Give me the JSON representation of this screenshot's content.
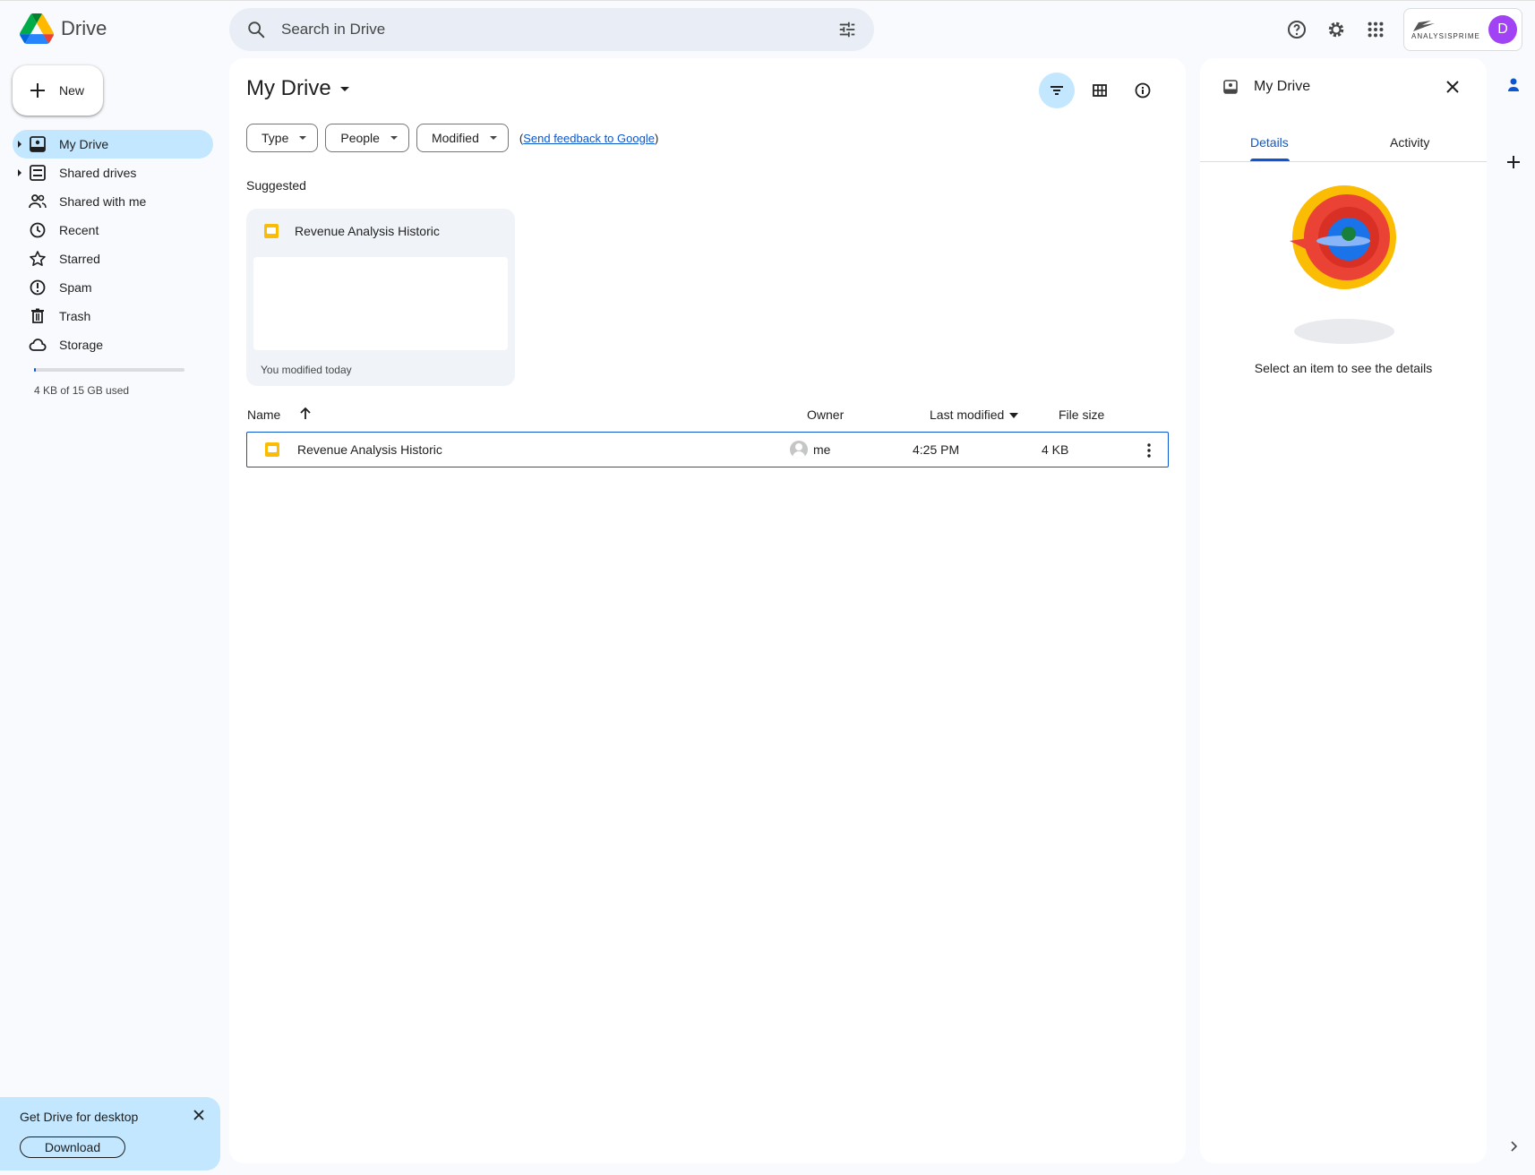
{
  "app": {
    "name": "Drive"
  },
  "search": {
    "placeholder": "Search in Drive"
  },
  "account": {
    "org_name": "ANALYSISPRIME",
    "avatar_letter": "D",
    "avatar_color": "#a142f4"
  },
  "sidebar": {
    "new_label": "New",
    "items": [
      {
        "label": "My Drive",
        "icon": "my-drive-icon",
        "active": true,
        "expandable": true
      },
      {
        "label": "Shared drives",
        "icon": "shared-drives-icon",
        "active": false,
        "expandable": true
      },
      {
        "label": "Shared with me",
        "icon": "people-icon",
        "active": false
      },
      {
        "label": "Recent",
        "icon": "clock-icon",
        "active": false
      },
      {
        "label": "Starred",
        "icon": "star-icon",
        "active": false
      },
      {
        "label": "Spam",
        "icon": "spam-icon",
        "active": false
      },
      {
        "label": "Trash",
        "icon": "trash-icon",
        "active": false
      },
      {
        "label": "Storage",
        "icon": "cloud-icon",
        "active": false
      }
    ],
    "storage_text": "4 KB of 15 GB used",
    "storage_fraction": 0.01
  },
  "promo": {
    "title": "Get Drive for desktop",
    "button": "Download"
  },
  "main": {
    "title": "My Drive",
    "filters": [
      "Type",
      "People",
      "Modified"
    ],
    "feedback_open": "(",
    "feedback_link": "Send feedback to Google",
    "feedback_close": ")",
    "suggested_label": "Suggested",
    "suggested_card": {
      "name": "Revenue Analysis Historic",
      "footer": "You modified today"
    },
    "columns": {
      "name": "Name",
      "owner": "Owner",
      "modified": "Last modified",
      "size": "File size"
    },
    "rows": [
      {
        "name": "Revenue Analysis Historic",
        "owner": "me",
        "modified": "4:25 PM",
        "size": "4 KB",
        "type": "slides"
      }
    ]
  },
  "details": {
    "title": "My Drive",
    "tabs": [
      "Details",
      "Activity"
    ],
    "active_tab": "Details",
    "message": "Select an item to see the details"
  },
  "colors": {
    "accent": "#0b57d0",
    "active_bg": "#c2e7ff",
    "page_bg": "#f8fafd",
    "slides": "#fbbc04"
  }
}
